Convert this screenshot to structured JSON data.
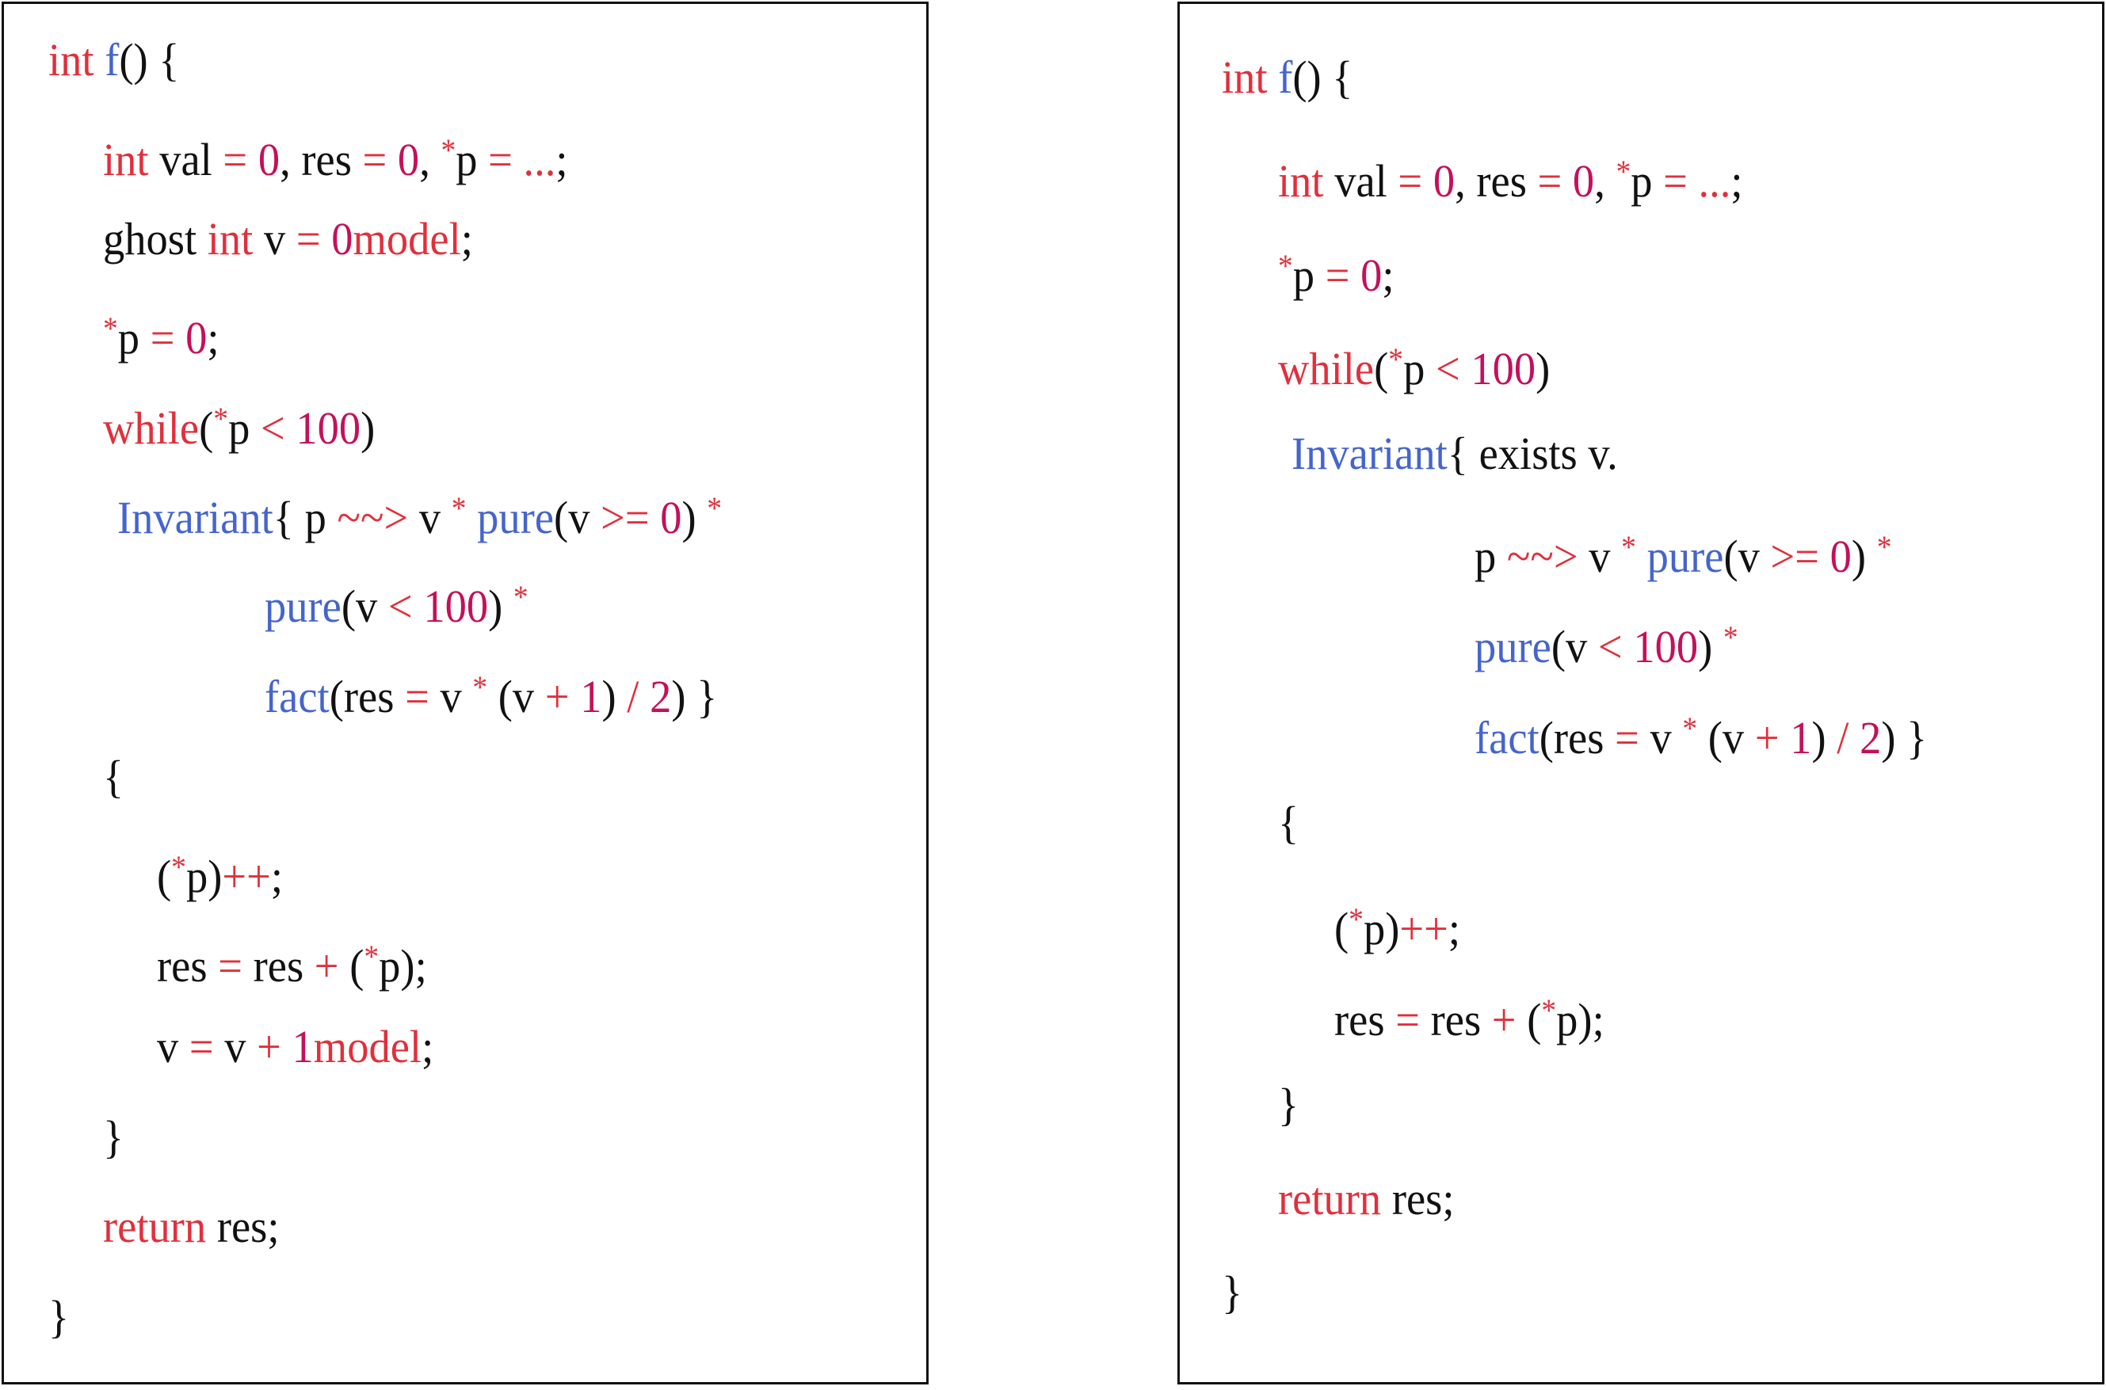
{
  "colors": {
    "keyword": "#e0303c",
    "number": "#c4105a",
    "function": "#4565cc",
    "operator": "#e0303c",
    "text": "#111111"
  },
  "left_listing": {
    "lines": [
      [
        [
          "k",
          "int "
        ],
        [
          "b",
          "f"
        ],
        [
          "p",
          "() {"
        ]
      ],
      [
        [
          "k",
          "int"
        ],
        [
          "p",
          " val "
        ],
        [
          "o",
          "="
        ],
        [
          "p",
          " "
        ],
        [
          "n",
          "0"
        ],
        [
          "p",
          ", res "
        ],
        [
          "o",
          "="
        ],
        [
          "p",
          " "
        ],
        [
          "n",
          "0"
        ],
        [
          "p",
          ", "
        ],
        [
          "s",
          "*"
        ],
        [
          "p",
          "p "
        ],
        [
          "o",
          "= ..."
        ],
        [
          "p",
          ";"
        ]
      ],
      [
        [
          "p",
          "ghost "
        ],
        [
          "k",
          "int"
        ],
        [
          "p",
          " v "
        ],
        [
          "o",
          "="
        ],
        [
          "p",
          " "
        ],
        [
          "n",
          "0"
        ],
        [
          "k",
          "model"
        ],
        [
          "p",
          ";"
        ]
      ],
      [
        [
          "s",
          "*"
        ],
        [
          "p",
          "p "
        ],
        [
          "o",
          "="
        ],
        [
          "p",
          " "
        ],
        [
          "n",
          "0"
        ],
        [
          "p",
          ";"
        ]
      ],
      [
        [
          "k",
          "while"
        ],
        [
          "p",
          "("
        ],
        [
          "s",
          "*"
        ],
        [
          "p",
          "p "
        ],
        [
          "o",
          "<"
        ],
        [
          "p",
          " "
        ],
        [
          "n",
          "100"
        ],
        [
          "p",
          ")"
        ]
      ],
      [
        [
          "b",
          "Invariant"
        ],
        [
          "p",
          "{ p "
        ],
        [
          "o",
          "~~>"
        ],
        [
          "p",
          " v "
        ],
        [
          "s",
          "*"
        ],
        [
          "p",
          " "
        ],
        [
          "b",
          "pure"
        ],
        [
          "p",
          "(v "
        ],
        [
          "o",
          ">="
        ],
        [
          "p",
          " "
        ],
        [
          "n",
          "0"
        ],
        [
          "p",
          ") "
        ],
        [
          "s",
          "*"
        ]
      ],
      [
        [
          "b",
          "pure"
        ],
        [
          "p",
          "(v "
        ],
        [
          "o",
          "<"
        ],
        [
          "p",
          " "
        ],
        [
          "n",
          "100"
        ],
        [
          "p",
          ") "
        ],
        [
          "s",
          "*"
        ]
      ],
      [
        [
          "b",
          "fact"
        ],
        [
          "p",
          "(res "
        ],
        [
          "o",
          "="
        ],
        [
          "p",
          " v "
        ],
        [
          "s",
          "*"
        ],
        [
          "p",
          " (v "
        ],
        [
          "o",
          "+"
        ],
        [
          "p",
          " "
        ],
        [
          "n",
          "1"
        ],
        [
          "p",
          ") "
        ],
        [
          "o",
          "/"
        ],
        [
          "p",
          " "
        ],
        [
          "n",
          "2"
        ],
        [
          "p",
          ") }"
        ]
      ],
      [
        [
          "p",
          "{"
        ]
      ],
      [
        [
          "p",
          "("
        ],
        [
          "s",
          "*"
        ],
        [
          "p",
          "p)"
        ],
        [
          "o",
          "++"
        ],
        [
          "p",
          ";"
        ]
      ],
      [
        [
          "p",
          "res "
        ],
        [
          "o",
          "="
        ],
        [
          "p",
          " res "
        ],
        [
          "o",
          "+"
        ],
        [
          "p",
          " ("
        ],
        [
          "s",
          "*"
        ],
        [
          "p",
          "p);"
        ]
      ],
      [
        [
          "p",
          "v "
        ],
        [
          "o",
          "="
        ],
        [
          "p",
          " v "
        ],
        [
          "o",
          "+"
        ],
        [
          "p",
          " "
        ],
        [
          "n",
          "1"
        ],
        [
          "k",
          "model"
        ],
        [
          "p",
          ";"
        ]
      ],
      [
        [
          "p",
          "}"
        ]
      ],
      [
        [
          "k",
          "return"
        ],
        [
          "p",
          " res;"
        ]
      ],
      [
        [
          "p",
          "}"
        ]
      ]
    ]
  },
  "right_listing": {
    "lines": [
      [
        [
          "k",
          "int "
        ],
        [
          "b",
          "f"
        ],
        [
          "p",
          "() {"
        ]
      ],
      [
        [
          "k",
          "int"
        ],
        [
          "p",
          " val "
        ],
        [
          "o",
          "="
        ],
        [
          "p",
          " "
        ],
        [
          "n",
          "0"
        ],
        [
          "p",
          ", res "
        ],
        [
          "o",
          "="
        ],
        [
          "p",
          " "
        ],
        [
          "n",
          "0"
        ],
        [
          "p",
          ", "
        ],
        [
          "s",
          "*"
        ],
        [
          "p",
          "p "
        ],
        [
          "o",
          "= ..."
        ],
        [
          "p",
          ";"
        ]
      ],
      [
        [
          "s",
          "*"
        ],
        [
          "p",
          "p "
        ],
        [
          "o",
          "="
        ],
        [
          "p",
          " "
        ],
        [
          "n",
          "0"
        ],
        [
          "p",
          ";"
        ]
      ],
      [
        [
          "k",
          "while"
        ],
        [
          "p",
          "("
        ],
        [
          "s",
          "*"
        ],
        [
          "p",
          "p "
        ],
        [
          "o",
          "<"
        ],
        [
          "p",
          " "
        ],
        [
          "n",
          "100"
        ],
        [
          "p",
          ")"
        ]
      ],
      [
        [
          "b",
          "Invariant"
        ],
        [
          "p",
          "{ exists v."
        ]
      ],
      [
        [
          "p",
          "p "
        ],
        [
          "o",
          "~~>"
        ],
        [
          "p",
          " v "
        ],
        [
          "s",
          "*"
        ],
        [
          "p",
          " "
        ],
        [
          "b",
          "pure"
        ],
        [
          "p",
          "(v "
        ],
        [
          "o",
          ">="
        ],
        [
          "p",
          " "
        ],
        [
          "n",
          "0"
        ],
        [
          "p",
          ") "
        ],
        [
          "s",
          "*"
        ]
      ],
      [
        [
          "b",
          "pure"
        ],
        [
          "p",
          "(v "
        ],
        [
          "o",
          "<"
        ],
        [
          "p",
          " "
        ],
        [
          "n",
          "100"
        ],
        [
          "p",
          ") "
        ],
        [
          "s",
          "*"
        ]
      ],
      [
        [
          "b",
          "fact"
        ],
        [
          "p",
          "(res "
        ],
        [
          "o",
          "="
        ],
        [
          "p",
          " v "
        ],
        [
          "s",
          "*"
        ],
        [
          "p",
          " (v "
        ],
        [
          "o",
          "+"
        ],
        [
          "p",
          " "
        ],
        [
          "n",
          "1"
        ],
        [
          "p",
          ") "
        ],
        [
          "o",
          "/"
        ],
        [
          "p",
          " "
        ],
        [
          "n",
          "2"
        ],
        [
          "p",
          ") }"
        ]
      ],
      [
        [
          "p",
          "{"
        ]
      ],
      [
        [
          "p",
          "("
        ],
        [
          "s",
          "*"
        ],
        [
          "p",
          "p)"
        ],
        [
          "o",
          "++"
        ],
        [
          "p",
          ";"
        ]
      ],
      [
        [
          "p",
          "res "
        ],
        [
          "o",
          "="
        ],
        [
          "p",
          " res "
        ],
        [
          "o",
          "+"
        ],
        [
          "p",
          " ("
        ],
        [
          "s",
          "*"
        ],
        [
          "p",
          "p);"
        ]
      ],
      [
        [
          "p",
          "}"
        ]
      ],
      [
        [
          "k",
          "return"
        ],
        [
          "p",
          " res;"
        ]
      ],
      [
        [
          "p",
          "}"
        ]
      ]
    ]
  }
}
